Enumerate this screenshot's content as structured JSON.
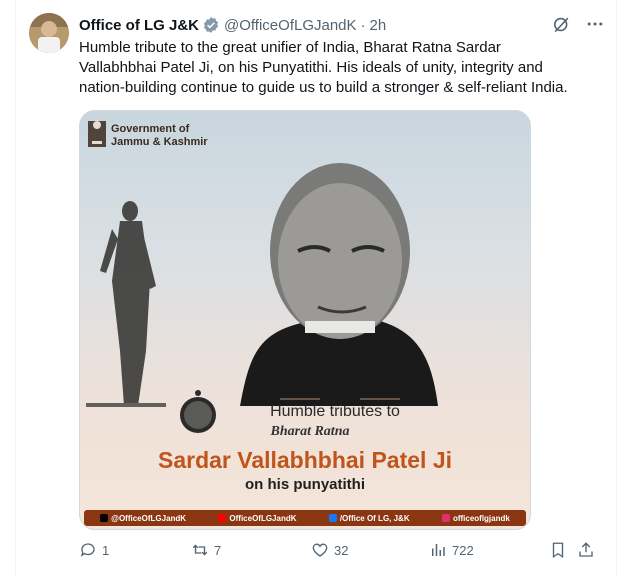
{
  "tweet": {
    "author_name": "Office of LG J&K",
    "handle": "@OfficeOfLGJandK",
    "separator": "·",
    "time": "2h",
    "text_lines": [
      "Humble tribute to the great unifier of India, Bharat Ratna Sardar",
      "Vallabhbhai Patel Ji, on his Punyatithi. His ideals of unity, integrity and",
      "nation-building continue to guide us to build a stronger & self-reliant India."
    ]
  },
  "media": {
    "gov_line1": "Government of",
    "gov_line2": "Jammu & Kashmir",
    "tribute_line1": "Humble tributes to",
    "tribute_line2": "Bharat Ratna",
    "tribute_name": "Sardar Vallabhbhai Patel Ji",
    "tribute_line4": "on his punyatithi",
    "social": [
      {
        "icon": "x-icon",
        "label": "@OfficeOfLGJandK"
      },
      {
        "icon": "youtube-icon",
        "label": "OfficeOfLGJandK"
      },
      {
        "icon": "facebook-icon",
        "label": "/Office Of LG, J&K"
      },
      {
        "icon": "instagram-icon",
        "label": "officeoflgjandk"
      }
    ]
  },
  "actions": {
    "replies": "1",
    "reposts": "7",
    "likes": "32",
    "views": "722"
  },
  "colors": {
    "text_primary": "#0f1419",
    "text_secondary": "#536471",
    "verified": "#829aab",
    "accent_orange": "#c0541d",
    "social_bar": "#8a3613"
  }
}
